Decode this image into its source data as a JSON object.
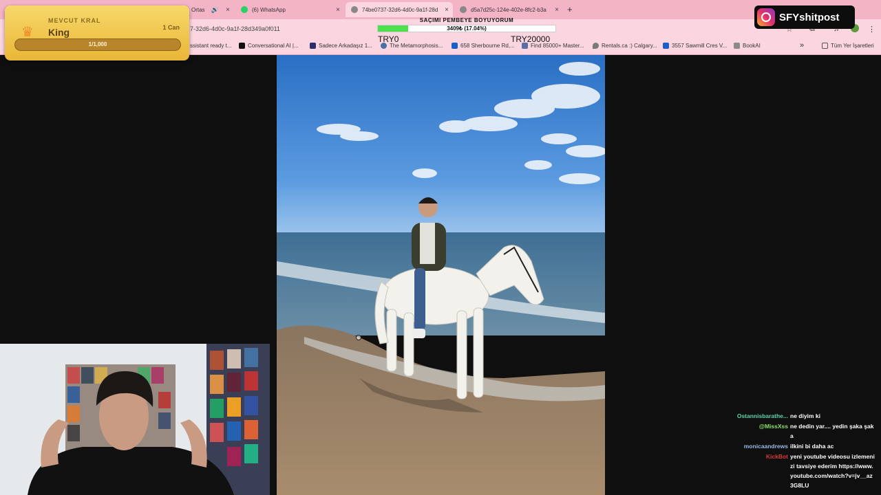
{
  "browser": {
    "tabs": [
      {
        "label": "Ortas",
        "close": "×",
        "icon_color": "#cc3333"
      },
      {
        "label": "(6) WhatsApp",
        "close": "×",
        "icon_color": "#25d366"
      },
      {
        "label": "74be0737-32d6-4d0c-9a1f-28d",
        "close": "×",
        "icon_color": "#888888",
        "active": true
      },
      {
        "label": "d5a7d25c-124e-402e-8fc2-b3a",
        "close": "×",
        "icon_color": "#888888"
      }
    ],
    "new_tab": "+",
    "url": "7-32d6-4d0c-9a1f-28d349a0f011",
    "bookmarks": [
      {
        "label": "ssistant ready t...",
        "icon_color": "#666666"
      },
      {
        "label": "Conversational AI |...",
        "icon_color": "#111111"
      },
      {
        "label": "Sadece Arkadaşız 1...",
        "icon_color": "#2d2d6b"
      },
      {
        "label": "The Metamorphosis...",
        "icon_color": "#4a6fa5"
      },
      {
        "label": "658 Sherbourne Rd,...",
        "icon_color": "#1a5fc7"
      },
      {
        "label": "Find 85000+ Master...",
        "icon_color": "#5a6fa5"
      },
      {
        "label": "Rentals.ca :) Calgary...",
        "icon_color": "#7a7a7a"
      },
      {
        "label": "3557 Sawmill Cres V...",
        "icon_color": "#1a5fc7"
      },
      {
        "label": "BookAI",
        "icon_color": "#8a8a8a"
      }
    ],
    "more": "»",
    "all_bookmarks": "Tüm Yer İşaretleri"
  },
  "king": {
    "subtitle": "MEVCUT KRAL",
    "name": "King",
    "count": "1 Can",
    "progress": "1/1,000"
  },
  "goal": {
    "title": "SAÇIMI PEMBEYE BOYUYORUM",
    "progress_text": "3409₺ (17.04%)",
    "percent": 17.04,
    "min_label": "TRY0",
    "max_label": "TRY20000"
  },
  "watermark": {
    "handle": "SFYshitpost"
  },
  "chat": [
    {
      "user": "Ostannisbarathe...",
      "color": "#5fd3a8",
      "text": "ne diyim ki"
    },
    {
      "user": "@MissXss",
      "color": "#8ee06a",
      "text": "ne dedin yar.... yedin şaka şaka"
    },
    {
      "user": "monicaandrews",
      "color": "#9ab8e6",
      "text": "ilkini bi daha ac"
    },
    {
      "user": "KickBot",
      "color": "#d93a3a",
      "text": "yeni youtube videosu izlemenizi tavsiye ederim https://www.youtube.com/watch?v=jv__az3G8LU"
    }
  ]
}
